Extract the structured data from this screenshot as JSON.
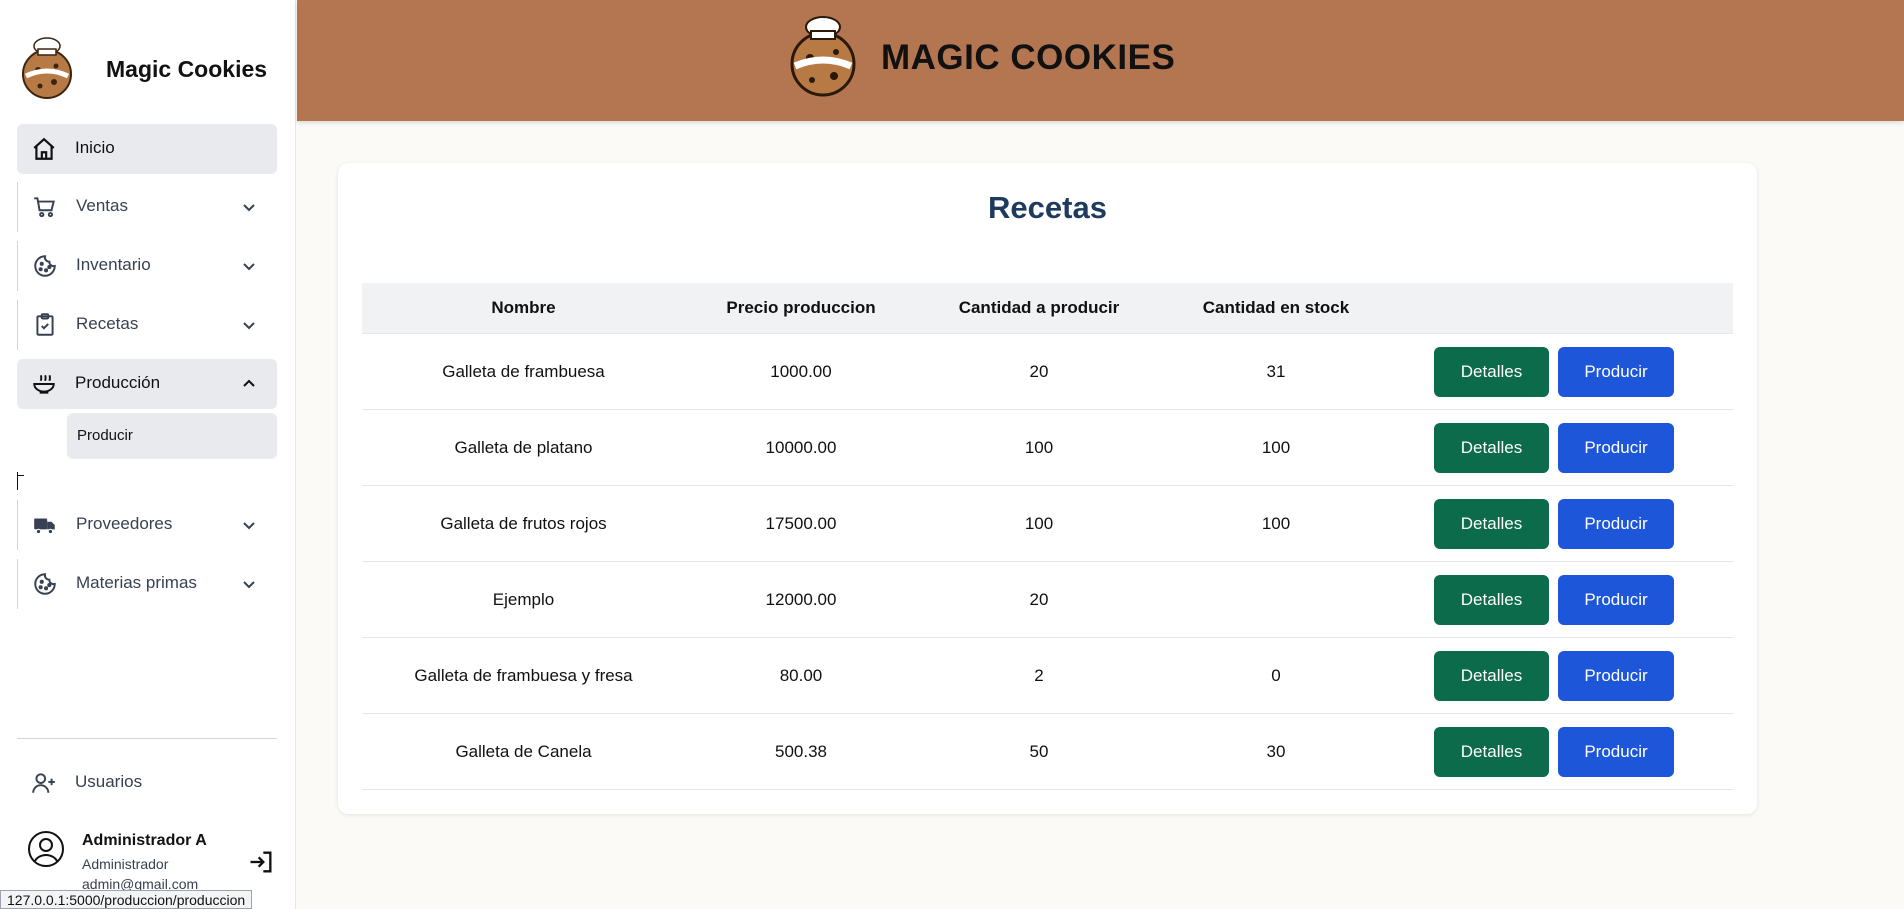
{
  "sidebar": {
    "brand": "Magic Cookies",
    "items": [
      {
        "label": "Inicio",
        "icon": "home-icon"
      },
      {
        "label": "Ventas",
        "icon": "cart-icon"
      },
      {
        "label": "Inventario",
        "icon": "cookie-icon"
      },
      {
        "label": "Recetas",
        "icon": "clipboard-check-icon"
      },
      {
        "label": "Producción",
        "icon": "bowl-icon"
      },
      {
        "label": "Proveedores",
        "icon": "truck-icon"
      },
      {
        "label": "Materias primas",
        "icon": "cookie-icon"
      }
    ],
    "subitem": "Producir",
    "users": "Usuarios",
    "user": {
      "name": "Administrador A",
      "role": "Administrador",
      "email": "admin@gmail.com"
    }
  },
  "header": {
    "title": "MAGIC COOKIES"
  },
  "main": {
    "title": "Recetas",
    "columns": [
      "Nombre",
      "Precio produccion",
      "Cantidad a producir",
      "Cantidad en stock",
      ""
    ],
    "rows": [
      {
        "nombre": "Galleta de frambuesa",
        "precio": "1000.00",
        "cantidad": "20",
        "stock": "31"
      },
      {
        "nombre": "Galleta de platano",
        "precio": "10000.00",
        "cantidad": "100",
        "stock": "100"
      },
      {
        "nombre": "Galleta de frutos rojos",
        "precio": "17500.00",
        "cantidad": "100",
        "stock": "100"
      },
      {
        "nombre": "Ejemplo",
        "precio": "12000.00",
        "cantidad": "20",
        "stock": ""
      },
      {
        "nombre": "Galleta de frambuesa y fresa",
        "precio": "80.00",
        "cantidad": "2",
        "stock": "0"
      },
      {
        "nombre": "Galleta de Canela",
        "precio": "500.38",
        "cantidad": "50",
        "stock": "30"
      }
    ],
    "detalles_label": "Detalles",
    "producir_label": "Producir"
  },
  "status_url": "127.0.0.1:5000/produccion/produccion",
  "colors": {
    "header_bg": "#b37650",
    "detalles_btn": "#0b6b4a",
    "producir_btn": "#1d56d8",
    "title": "#1e3a5f"
  }
}
